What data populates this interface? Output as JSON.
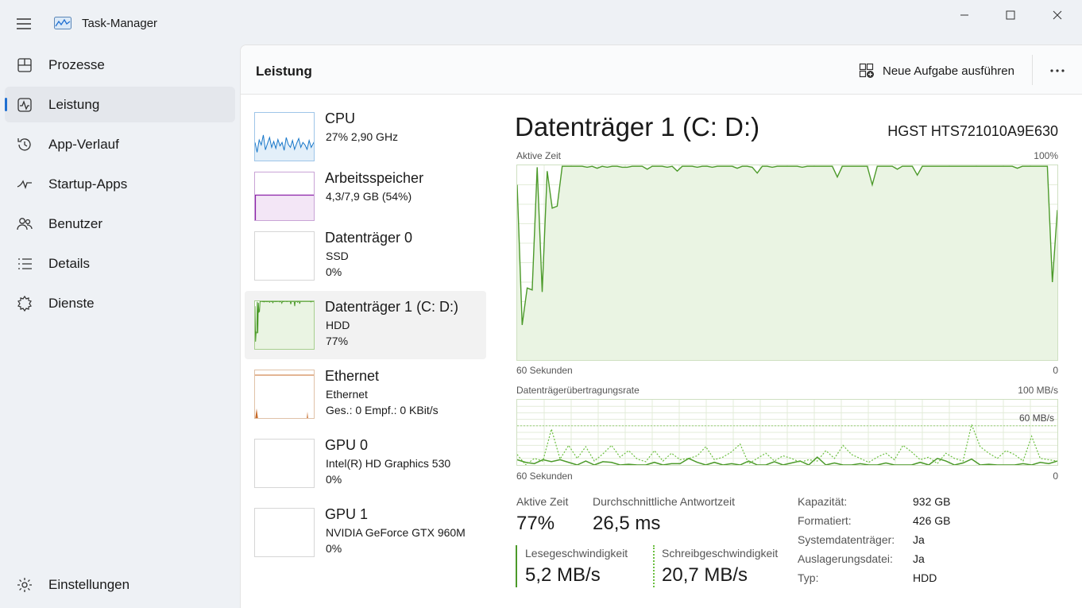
{
  "window": {
    "title": "Task-Manager"
  },
  "nav": {
    "items": [
      {
        "id": "prozesse",
        "label": "Prozesse",
        "icon": "processes-icon"
      },
      {
        "id": "leistung",
        "label": "Leistung",
        "icon": "performance-icon",
        "active": true
      },
      {
        "id": "app-verlauf",
        "label": "App-Verlauf",
        "icon": "history-icon"
      },
      {
        "id": "startup",
        "label": "Startup-Apps",
        "icon": "startup-icon"
      },
      {
        "id": "benutzer",
        "label": "Benutzer",
        "icon": "users-icon"
      },
      {
        "id": "details",
        "label": "Details",
        "icon": "details-icon"
      },
      {
        "id": "dienste",
        "label": "Dienste",
        "icon": "services-icon"
      }
    ],
    "settings_label": "Einstellungen"
  },
  "header": {
    "title": "Leistung",
    "new_task_label": "Neue Aufgabe ausführen"
  },
  "devices": [
    {
      "name": "CPU",
      "line1": "27%  2,90 GHz",
      "line2": "",
      "thumb": "cpu"
    },
    {
      "name": "Arbeitsspeicher",
      "line1": "4,3/7,9 GB (54%)",
      "line2": "",
      "thumb": "mem"
    },
    {
      "name": "Datenträger 0",
      "line1": "SSD",
      "line2": "0%",
      "thumb": "blank"
    },
    {
      "name": "Datenträger 1 (C: D:)",
      "line1": "HDD",
      "line2": "77%",
      "thumb": "disk",
      "active": true
    },
    {
      "name": "Ethernet",
      "line1": "Ethernet",
      "line2": "Ges.: 0  Empf.: 0 KBit/s",
      "thumb": "eth"
    },
    {
      "name": "GPU 0",
      "line1": "Intel(R) HD Graphics 530",
      "line2": "0%",
      "thumb": "blank"
    },
    {
      "name": "GPU 1",
      "line1": "NVIDIA GeForce GTX 960M",
      "line2": "0%",
      "thumb": "blank"
    }
  ],
  "detail": {
    "title": "Datenträger 1 (C: D:)",
    "model": "HGST HTS721010A9E630",
    "graph1": {
      "label": "Aktive Zeit",
      "max_label": "100%",
      "min_label": "0",
      "x_label": "60 Sekunden",
      "values": [
        90,
        18,
        37,
        36,
        99,
        35,
        97,
        78,
        79,
        99.5,
        99.5,
        99.5,
        99.5,
        99.5,
        99,
        99.5,
        98.5,
        99.5,
        99,
        99.5,
        99.5,
        99,
        99,
        99.5,
        99.5,
        99.5,
        98,
        99.5,
        99.5,
        99.5,
        99,
        99.5,
        97,
        99.5,
        99.5,
        99.5,
        99,
        99.5,
        99.5,
        99,
        99.5,
        99.5,
        99.5,
        99.5,
        98.5,
        99.5,
        99.5,
        99,
        96,
        99.5,
        99.5,
        99,
        99.5,
        99.5,
        99.5,
        99.5,
        99.5,
        99,
        99.5,
        99.5,
        99.5,
        99.5,
        99.5,
        99.5,
        94,
        99.5,
        99.5,
        99.5,
        99.5,
        99.5,
        99.5,
        90,
        99.5,
        99.5,
        99.5,
        99.5,
        98,
        99.5,
        99.5,
        99.5,
        95,
        99.5,
        99.5,
        99.5,
        99.5,
        99.5,
        99.5,
        99.5,
        99.5,
        99.5,
        99.5,
        99.5,
        99.5,
        99.5,
        99.5,
        99.5,
        99.5,
        99.5,
        99.5,
        99.5,
        98.5,
        99.5,
        99.5,
        99.5,
        99.5,
        99.5,
        99.5,
        40,
        77
      ]
    },
    "graph2": {
      "label": "Datenträgerübertragungsrate",
      "max_label": "100 MB/s",
      "mid_label": "60 MB/s",
      "min_label": "0",
      "x_label": "60 Sekunden",
      "read": [
        8,
        4,
        2,
        8,
        5,
        8,
        4,
        0,
        6,
        0,
        5,
        4,
        0,
        1,
        0,
        0,
        4,
        0,
        2,
        2,
        10,
        4,
        0,
        4,
        0,
        2,
        0,
        6,
        0,
        0,
        5,
        0,
        3,
        6,
        0,
        12,
        0,
        3,
        0,
        0,
        2,
        0,
        0,
        3,
        0,
        0,
        0,
        4,
        0,
        10,
        6,
        0,
        3,
        9,
        0,
        1,
        0,
        0,
        0,
        2,
        0,
        4,
        2,
        6
      ],
      "write": [
        16,
        0,
        10,
        6,
        55,
        9,
        30,
        10,
        28,
        6,
        17,
        30,
        12,
        22,
        9,
        5,
        22,
        6,
        18,
        8,
        10,
        14,
        28,
        8,
        12,
        20,
        32,
        2,
        10,
        18,
        6,
        14,
        10,
        4,
        8,
        6,
        22,
        10,
        30,
        16,
        10,
        4,
        12,
        18,
        8,
        30,
        20,
        8,
        12,
        2,
        18,
        10,
        6,
        62,
        28,
        18,
        10,
        22,
        16,
        6,
        44,
        10,
        8,
        6
      ]
    },
    "stats": {
      "active_time_label": "Aktive Zeit",
      "active_time_value": "77%",
      "response_label": "Durchschnittliche Antwortzeit",
      "response_value": "26,5 ms",
      "read_label": "Lesegeschwindigkeit",
      "read_value": "5,2 MB/s",
      "write_label": "Schreibgeschwindigkeit",
      "write_value": "20,7 MB/s"
    },
    "props": [
      {
        "k": "Kapazität:",
        "v": "932 GB"
      },
      {
        "k": "Formatiert:",
        "v": "426 GB"
      },
      {
        "k": "Systemdatenträger:",
        "v": "Ja"
      },
      {
        "k": "Auslagerungsdatei:",
        "v": "Ja"
      },
      {
        "k": "Typ:",
        "v": "HDD"
      }
    ]
  },
  "colors": {
    "disk_line": "#4c9a2a",
    "disk_fill": "#eaf4e3",
    "grid": "#e3ecd9",
    "cpu": "#1877c9",
    "mem": "#8b21a8",
    "eth": "#c76b2a",
    "accent": "#1f6fd1"
  }
}
